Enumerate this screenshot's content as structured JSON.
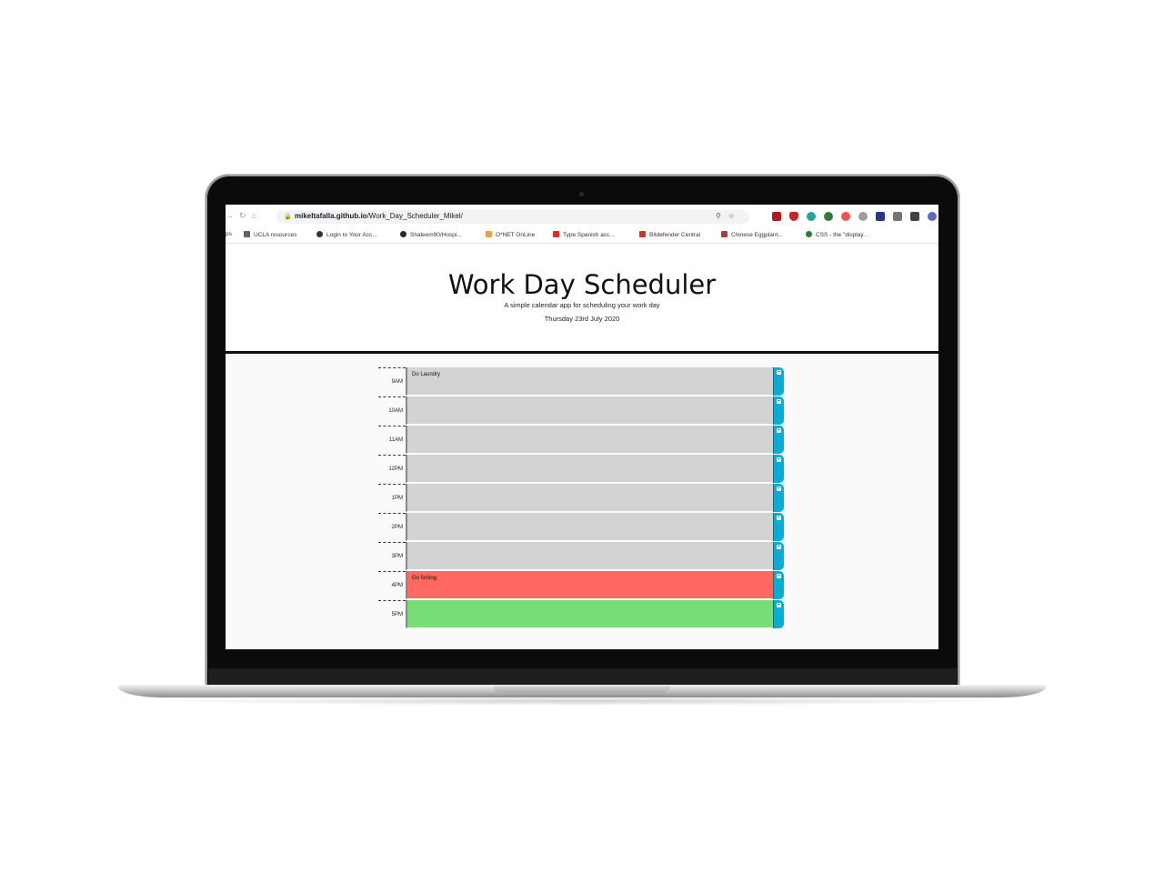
{
  "browser": {
    "url_domain": "mikeltafalla.github.io",
    "url_path": "/Work_Day_Scheduler_Mikel/",
    "bookmarks": [
      {
        "label": "ps",
        "color": "#9aa0a6"
      },
      {
        "label": "UCLA resources",
        "color": "#5f6368"
      },
      {
        "label": "Login to Your Acc...",
        "color": "#333333"
      },
      {
        "label": "Shaleem90/Hospi...",
        "color": "#24292e"
      },
      {
        "label": "O*NET OnLine",
        "color": "#e8a13a"
      },
      {
        "label": "Type Spanish acc...",
        "color": "#d93025"
      },
      {
        "label": "Bitdefender Central",
        "color": "#d93025"
      },
      {
        "label": "Chinese Eggplant...",
        "color": "#b23a3a"
      },
      {
        "label": "CSS - the \"display...",
        "color": "#2e7d32"
      }
    ]
  },
  "header": {
    "title": "Work Day Scheduler",
    "lead": "A simple calendar app for scheduling your work day",
    "date": "Thursday 23rd July 2020"
  },
  "schedule": [
    {
      "hour": "9AM",
      "text": "Do Laundry",
      "state": "past"
    },
    {
      "hour": "10AM",
      "text": "",
      "state": "past"
    },
    {
      "hour": "11AM",
      "text": "",
      "state": "past"
    },
    {
      "hour": "12PM",
      "text": "",
      "state": "past"
    },
    {
      "hour": "1PM",
      "text": "",
      "state": "past"
    },
    {
      "hour": "2PM",
      "text": "",
      "state": "past"
    },
    {
      "hour": "3PM",
      "text": "",
      "state": "past"
    },
    {
      "hour": "4PM",
      "text": "Go fishing",
      "state": "present"
    },
    {
      "hour": "5PM",
      "text": "",
      "state": "future"
    }
  ],
  "colors": {
    "past": "#d3d3d3",
    "present": "#ff6961",
    "future": "#77dd77",
    "save": "#06aed5"
  }
}
